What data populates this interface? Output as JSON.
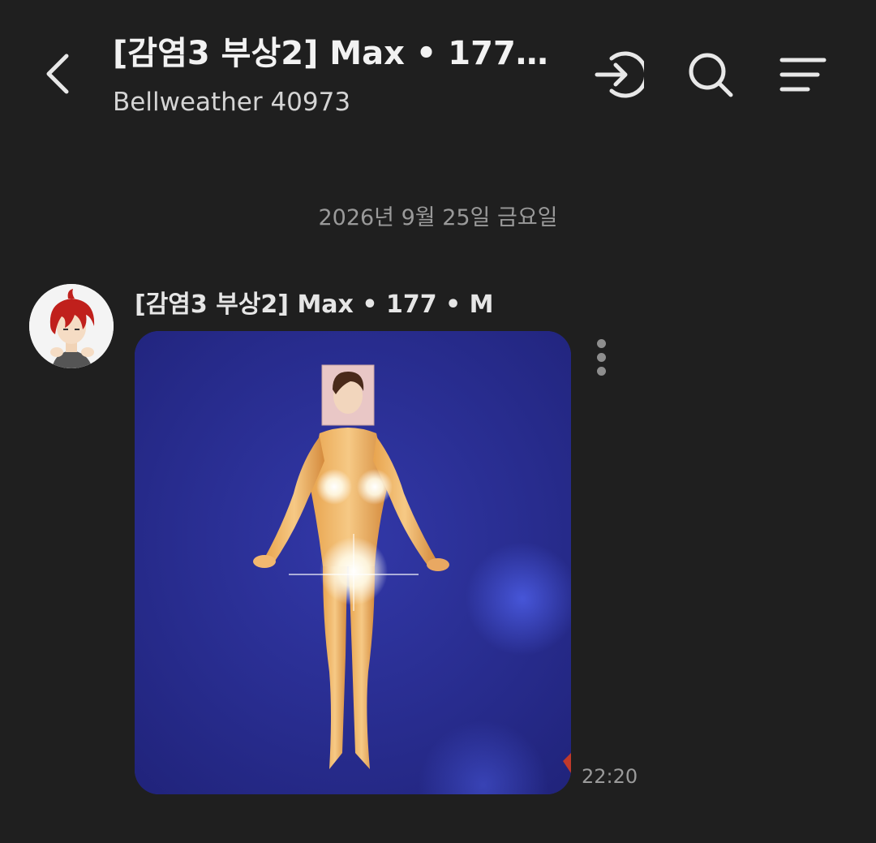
{
  "header": {
    "title": "[감염3 부상2] Max • 177…",
    "subtitle": "Bellweather 40973",
    "back_icon": "chevron-left-icon",
    "actions": [
      "enter-room-icon",
      "search-icon",
      "menu-icon"
    ]
  },
  "chat": {
    "date_divider": "2026년 9월 25일 금요일",
    "messages": [
      {
        "sender": "[감염3 부상2] Max • 177 • M",
        "type": "image",
        "time": "22:20"
      }
    ]
  },
  "colors": {
    "background": "#1f1f1f",
    "photo_background": "#2a2e8c",
    "avatar_hair": "#c0201c"
  }
}
